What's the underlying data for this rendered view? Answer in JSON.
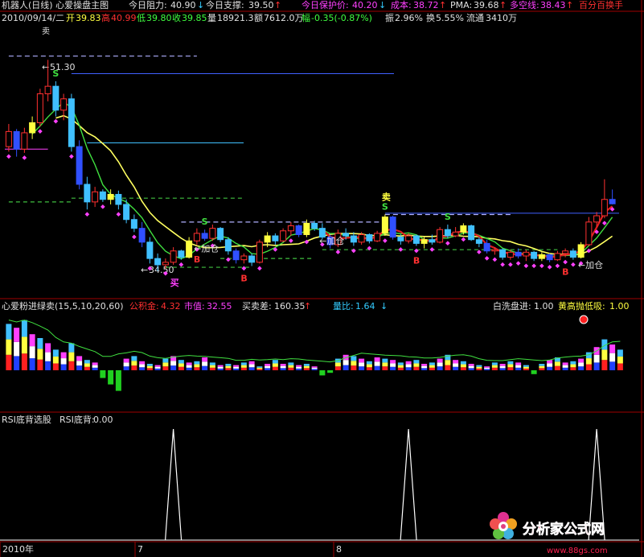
{
  "chart_data": [
    {
      "type": "candlestick",
      "title": "机器人(日线) 心爱操盘主图",
      "header": {
        "title": "机器人(日线) 心爱操盘主图",
        "resist_label": "今日阻力:",
        "resist_value": "40.90",
        "support_label": "今日支撑:",
        "support_value": "39.50",
        "protect_label": "今日保护价:",
        "protect_value": "40.20",
        "cost_label": "成本:",
        "cost_value": "38.72",
        "pma_label": "PMA:",
        "pma_value": "39.68",
        "bull_label": "多空线:",
        "bull_value": "38.43",
        "hand_label": "百分百换手"
      },
      "quote": {
        "date": "2010/09/14/二",
        "open_label": "开",
        "open": "39.83",
        "high_label": "高",
        "high": "40.99",
        "low_label": "低",
        "low": "39.80",
        "close_label": "收",
        "close": "39.85",
        "volume_label": "量",
        "volume": "18921.3",
        "amount_label": "额",
        "amount": "7612.0万",
        "change_label": "幅",
        "change": "-0.35(-0.87%)",
        "amplitude_label": "振",
        "amplitude": "2.96%",
        "turnover_label": "换",
        "turnover": "5.55%",
        "float_label": "流通",
        "float": "3410万"
      },
      "price_range": [
        32.5,
        53.5
      ],
      "candles": [
        [
          44.4,
          46.2,
          44.0,
          45.6
        ],
        [
          45.6,
          45.8,
          43.6,
          44.2
        ],
        [
          44.2,
          45.9,
          43.9,
          45.5
        ],
        [
          45.5,
          46.8,
          45.0,
          46.3
        ],
        [
          46.3,
          49.0,
          46.0,
          48.6
        ],
        [
          48.6,
          51.3,
          48.0,
          49.2
        ],
        [
          49.2,
          49.6,
          46.8,
          47.3
        ],
        [
          47.3,
          48.6,
          46.5,
          48.2
        ],
        [
          48.2,
          48.6,
          44.0,
          44.4
        ],
        [
          44.4,
          44.9,
          41.0,
          41.4
        ],
        [
          41.4,
          42.0,
          39.4,
          40.0
        ],
        [
          40.0,
          41.2,
          39.6,
          40.8
        ],
        [
          40.8,
          41.0,
          40.0,
          40.2
        ],
        [
          40.2,
          41.0,
          39.8,
          40.6
        ],
        [
          40.6,
          40.9,
          39.4,
          39.8
        ],
        [
          39.8,
          40.2,
          38.3,
          38.6
        ],
        [
          38.6,
          39.0,
          37.6,
          37.9
        ],
        [
          37.9,
          38.4,
          36.4,
          36.8
        ],
        [
          36.8,
          37.2,
          35.1,
          35.5
        ],
        [
          35.5,
          35.9,
          34.5,
          35.0
        ],
        [
          35.0,
          35.5,
          34.7,
          35.2
        ],
        [
          35.2,
          36.4,
          35.0,
          36.1
        ],
        [
          36.1,
          36.2,
          35.4,
          35.6
        ],
        [
          35.6,
          37.2,
          35.5,
          36.9
        ],
        [
          36.9,
          37.9,
          36.6,
          37.5
        ],
        [
          37.5,
          37.8,
          36.9,
          37.1
        ],
        [
          37.1,
          38.2,
          36.9,
          37.9
        ],
        [
          37.9,
          38.0,
          36.8,
          37.0
        ],
        [
          37.0,
          37.2,
          35.8,
          36.1
        ],
        [
          36.1,
          36.3,
          35.1,
          35.4
        ],
        [
          35.4,
          35.9,
          35.1,
          35.7
        ],
        [
          35.7,
          35.9,
          34.9,
          35.2
        ],
        [
          35.2,
          37.0,
          35.1,
          36.8
        ],
        [
          36.8,
          37.6,
          36.4,
          37.3
        ],
        [
          37.3,
          37.5,
          36.6,
          36.9
        ],
        [
          36.9,
          37.9,
          36.8,
          37.7
        ],
        [
          37.7,
          38.4,
          37.3,
          38.1
        ],
        [
          38.1,
          38.2,
          37.2,
          37.4
        ],
        [
          37.4,
          38.6,
          37.2,
          38.3
        ],
        [
          38.3,
          38.5,
          37.7,
          37.9
        ],
        [
          37.9,
          38.3,
          37.0,
          37.2
        ],
        [
          37.2,
          37.4,
          36.3,
          36.6
        ],
        [
          36.6,
          37.8,
          36.4,
          37.5
        ],
        [
          37.5,
          37.9,
          37.0,
          37.3
        ],
        [
          37.3,
          37.6,
          36.5,
          36.8
        ],
        [
          36.8,
          37.6,
          36.6,
          37.4
        ],
        [
          37.4,
          37.5,
          36.7,
          36.9
        ],
        [
          36.9,
          37.7,
          36.8,
          37.5
        ],
        [
          37.5,
          39.0,
          37.3,
          38.8
        ],
        [
          38.8,
          38.9,
          37.0,
          37.2
        ],
        [
          37.2,
          37.4,
          36.6,
          36.9
        ],
        [
          36.9,
          37.5,
          36.7,
          37.3
        ],
        [
          37.3,
          37.4,
          36.5,
          36.7
        ],
        [
          36.7,
          37.2,
          36.3,
          37.0
        ],
        [
          37.0,
          37.4,
          36.6,
          36.8
        ],
        [
          36.8,
          38.0,
          36.7,
          37.8
        ],
        [
          37.8,
          38.2,
          37.1,
          37.3
        ],
        [
          37.3,
          38.0,
          37.2,
          37.6
        ],
        [
          37.6,
          38.3,
          37.4,
          38.1
        ],
        [
          38.1,
          38.2,
          36.9,
          37.0
        ],
        [
          37.0,
          37.2,
          36.4,
          36.7
        ],
        [
          36.7,
          37.0,
          35.9,
          36.1
        ],
        [
          36.1,
          36.4,
          35.8,
          36.2
        ],
        [
          36.2,
          36.3,
          35.4,
          35.6
        ],
        [
          35.6,
          36.2,
          35.4,
          36.0
        ],
        [
          36.0,
          36.3,
          35.5,
          35.7
        ],
        [
          35.7,
          36.2,
          35.3,
          36.0
        ],
        [
          36.0,
          36.1,
          35.3,
          35.5
        ],
        [
          35.5,
          36.0,
          35.3,
          35.8
        ],
        [
          35.8,
          35.9,
          35.2,
          35.4
        ],
        [
          35.4,
          36.1,
          35.3,
          35.9
        ],
        [
          35.9,
          36.3,
          35.6,
          36.1
        ],
        [
          36.1,
          36.3,
          35.4,
          35.6
        ],
        [
          35.6,
          36.8,
          35.5,
          36.6
        ],
        [
          36.6,
          38.8,
          36.5,
          38.4
        ],
        [
          38.4,
          39.2,
          38.0,
          38.9
        ],
        [
          38.9,
          41.8,
          38.7,
          40.2
        ],
        [
          40.2,
          40.99,
          39.8,
          39.85
        ]
      ],
      "signals": [
        {
          "text": "S",
          "index": 6,
          "kind": "sell"
        },
        {
          "text": "S",
          "index": 25,
          "kind": "sell"
        },
        {
          "text": "卖",
          "index": 48,
          "kind": "sell"
        },
        {
          "text": "S",
          "index": 48,
          "kind": "sell"
        },
        {
          "text": "S",
          "index": 56,
          "kind": "sell"
        },
        {
          "text": "B",
          "index": 24,
          "kind": "buy"
        },
        {
          "text": "买",
          "index": 21,
          "kind": "buy"
        },
        {
          "text": "B",
          "index": 30,
          "kind": "buy"
        },
        {
          "text": "B",
          "index": 52,
          "kind": "buy"
        },
        {
          "text": "B",
          "index": 71,
          "kind": "buy"
        }
      ],
      "annotations": {
        "high_mark": "51.30",
        "low_mark": "34.50",
        "add_pos": "加仓",
        "top_mark": "卖"
      }
    },
    {
      "type": "bar",
      "title": "心爱粉进绿卖(15,5,10,20,60)",
      "header": {
        "title": "心爱粉进绿卖(15,5,10,20,60)",
        "fund_label": "公积金:",
        "fund_value": "4.32",
        "pe_label": "市值:",
        "pe_value": "32.55",
        "diff_label": "买卖差:",
        "diff_value": "160.35",
        "vr_label": "量比:",
        "vr_value": "1.64",
        "white_label": "白洗盘进:",
        "white_value": "1.00",
        "yellow_label": "黄高抛低吸:",
        "yellow_value": "1.00"
      },
      "values": [
        3.6,
        3.3,
        3.9,
        2.8,
        2.5,
        2.1,
        1.6,
        1.4,
        2.1,
        1.1,
        0.8,
        0.6,
        -0.6,
        -1.1,
        -1.6,
        0.9,
        1.1,
        0.7,
        0.5,
        0.4,
        0.9,
        1.1,
        0.8,
        0.6,
        0.7,
        1.0,
        0.6,
        0.4,
        0.5,
        0.4,
        0.6,
        0.7,
        0.3,
        0.5,
        0.8,
        0.5,
        0.6,
        0.4,
        0.5,
        0.3,
        -0.4,
        -0.2,
        0.9,
        1.2,
        1.1,
        0.9,
        0.7,
        1.0,
        0.9,
        0.8,
        0.6,
        0.7,
        0.8,
        0.5,
        0.6,
        0.9,
        1.2,
        0.8,
        0.7,
        0.5,
        0.4,
        0.3,
        0.6,
        0.5,
        0.7,
        0.6,
        0.4,
        -0.3,
        0.5,
        0.8,
        1.0,
        0.6,
        0.7,
        0.9,
        1.4,
        1.8,
        2.4,
        2.0,
        1.6
      ]
    },
    {
      "type": "line",
      "title": "RSI底背选股",
      "header": {
        "title": "RSI底背选股",
        "value_label": "RSI底背:",
        "value": "0.00"
      },
      "x_labels": [
        "2010年",
        "7",
        "8"
      ],
      "peaks": [
        21,
        51,
        75
      ],
      "ylim": [
        0,
        1
      ]
    }
  ],
  "logo": {
    "text": "分析家公式网",
    "url": "www.88gs.com"
  }
}
